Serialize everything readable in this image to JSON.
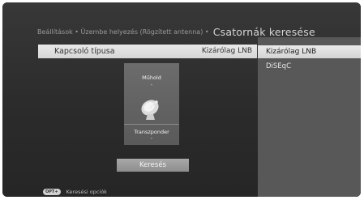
{
  "breadcrumb": {
    "path": "Beállítások • Üzembe helyezés (Rögzített antenna) •",
    "current": "Csatornák keresése"
  },
  "setting_row": {
    "label": "Kapcsoló típusa",
    "value": "Kizárólag LNB"
  },
  "dropdown": {
    "options": [
      "Kizárólag LNB",
      "DiSEqC"
    ],
    "selected": "Kizárólag LNB"
  },
  "satellite_card": {
    "top_label": "Műhold",
    "top_value": "-",
    "bottom_label": "Transzponder",
    "bottom_value": "-",
    "icon": "satellite-dish-icon"
  },
  "search_button": {
    "label": "Keresés"
  },
  "footer": {
    "key_label": "OPT+",
    "hint": "Keresési opciók"
  }
}
